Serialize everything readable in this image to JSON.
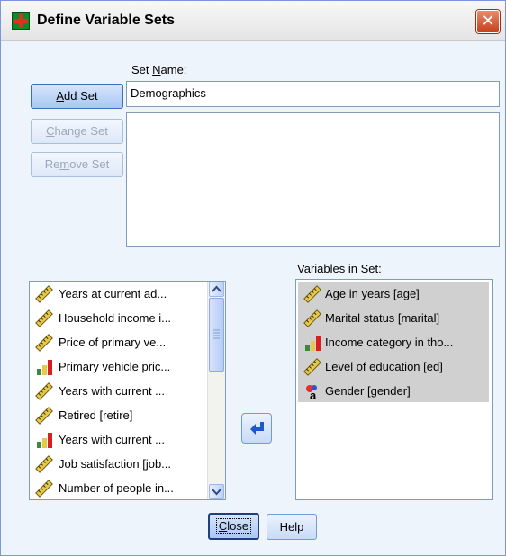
{
  "window": {
    "title": "Define Variable Sets",
    "close_glyph": "✕"
  },
  "set_name": {
    "label_pre": "Set ",
    "label_mnemonic": "N",
    "label_post": "ame:",
    "value": "Demographics"
  },
  "buttons": {
    "add_pre": "",
    "add_mnemonic": "A",
    "add_post": "dd Set",
    "change_pre": "",
    "change_mnemonic": "C",
    "change_post": "hange Set",
    "remove_pre": "Re",
    "remove_mnemonic": "m",
    "remove_post": "ove Set",
    "close_pre": "",
    "close_mnemonic": "C",
    "close_post": "lose",
    "help_label": "Help"
  },
  "available_variables": [
    {
      "label": "Years at current ad...",
      "icon": "scale-ruler-icon"
    },
    {
      "label": "Household income i...",
      "icon": "scale-ruler-icon"
    },
    {
      "label": "Price of primary ve...",
      "icon": "scale-ruler-icon"
    },
    {
      "label": "Primary vehicle pric...",
      "icon": "ordinal-bars-icon"
    },
    {
      "label": "Years with current ...",
      "icon": "scale-ruler-icon"
    },
    {
      "label": "Retired [retire]",
      "icon": "scale-ruler-icon"
    },
    {
      "label": "Years with current ...",
      "icon": "ordinal-bars-icon"
    },
    {
      "label": "Job satisfaction [job...",
      "icon": "scale-ruler-icon"
    },
    {
      "label": "Number of people in...",
      "icon": "scale-ruler-icon"
    }
  ],
  "variables_in_set": {
    "label_pre": "",
    "label_mnemonic": "V",
    "label_post": "ariables in Set:",
    "items": [
      {
        "label": "Age in years [age]",
        "icon": "scale-ruler-icon"
      },
      {
        "label": "Marital status [marital]",
        "icon": "scale-ruler-icon"
      },
      {
        "label": "Income category in tho...",
        "icon": "ordinal-bars-icon"
      },
      {
        "label": "Level of education [ed]",
        "icon": "scale-ruler-icon"
      },
      {
        "label": "Gender [gender]",
        "icon": "nominal-string-icon"
      }
    ]
  },
  "colors": {
    "dialog_bg": "#eef4fc",
    "selection_bg": "#d0d0d0",
    "button_border": "#6f9bd6",
    "close_button": "#c4401c"
  }
}
